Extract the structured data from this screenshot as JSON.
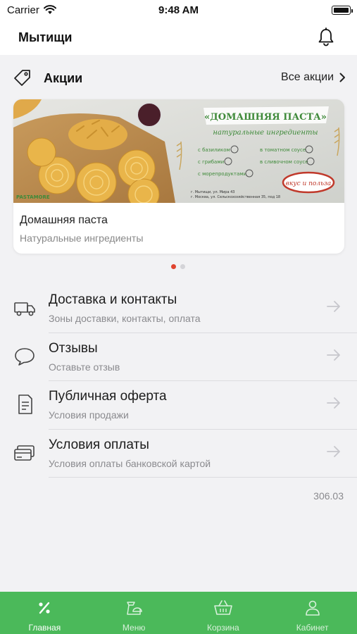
{
  "status_bar": {
    "carrier": "Carrier",
    "time": "9:48 AM"
  },
  "header": {
    "city": "Мытищи"
  },
  "promotions": {
    "title": "Акции",
    "all_link": "Все акции",
    "banner": {
      "headline": "«ДОМАШНЯЯ ПАСТА»",
      "tagline": "натуральные ингредиенты",
      "features": [
        "с базиликом",
        "в томатном соусе",
        "с грибами",
        "в сливочном соусе",
        "с морепродуктами"
      ],
      "address1": "г. Мытищи, ул. Мира 43",
      "address2": "г. Москва, ул. Сельскохозяйственная 35, под 18",
      "stamp": "вкус и польза",
      "brand": "PASTAMORE"
    },
    "card_title": "Домашняя паста",
    "card_subtitle": "Натуральные ингредиенты",
    "page_count": 2,
    "active_page": 0
  },
  "menu": [
    {
      "title": "Доставка и контакты",
      "subtitle": "Зоны доставки, контакты, оплата",
      "icon": "truck-icon"
    },
    {
      "title": "Отзывы",
      "subtitle": "Оставьте отзыв",
      "icon": "speech-bubble-icon"
    },
    {
      "title": "Публичная оферта",
      "subtitle": "Условия продажи",
      "icon": "document-icon"
    },
    {
      "title": "Условия оплаты",
      "subtitle": "Условия оплаты банковской картой",
      "icon": "credit-card-icon"
    }
  ],
  "version": "306.03",
  "tabs": [
    {
      "label": "Главная",
      "icon": "percent-icon",
      "active": true
    },
    {
      "label": "Меню",
      "icon": "menu-dish-icon",
      "active": false
    },
    {
      "label": "Корзина",
      "icon": "basket-icon",
      "active": false
    },
    {
      "label": "Кабинет",
      "icon": "person-icon",
      "active": false
    }
  ],
  "colors": {
    "accent_green": "#4bb95a",
    "dot_active": "#e0442f",
    "banner_green": "#3f8a3a"
  }
}
